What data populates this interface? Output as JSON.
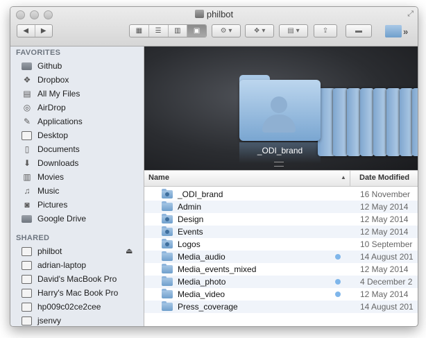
{
  "window": {
    "title": "philbot"
  },
  "toolbar": {
    "back_icon": "chevron-left-icon",
    "forward_icon": "chevron-right-icon",
    "view_modes": [
      "icon-view",
      "list-view",
      "column-view",
      "cover-flow-view"
    ],
    "active_view": "cover-flow-view",
    "more": "»"
  },
  "sidebar": {
    "favorites_header": "FAVORITES",
    "favorites": [
      {
        "label": "Github",
        "icon": "folder-icon"
      },
      {
        "label": "Dropbox",
        "icon": "dropbox-icon"
      },
      {
        "label": "All My Files",
        "icon": "all-files-icon"
      },
      {
        "label": "AirDrop",
        "icon": "airdrop-icon"
      },
      {
        "label": "Applications",
        "icon": "applications-icon"
      },
      {
        "label": "Desktop",
        "icon": "desktop-icon"
      },
      {
        "label": "Documents",
        "icon": "documents-icon"
      },
      {
        "label": "Downloads",
        "icon": "downloads-icon"
      },
      {
        "label": "Movies",
        "icon": "movies-icon"
      },
      {
        "label": "Music",
        "icon": "music-icon"
      },
      {
        "label": "Pictures",
        "icon": "pictures-icon"
      },
      {
        "label": "Google Drive",
        "icon": "folder-icon"
      }
    ],
    "shared_header": "SHARED",
    "shared": [
      {
        "label": "philbot",
        "icon": "computer-icon"
      },
      {
        "label": "adrian-laptop",
        "icon": "computer-icon"
      },
      {
        "label": "David's MacBook Pro",
        "icon": "laptop-icon"
      },
      {
        "label": "Harry's Mac Book Pro",
        "icon": "laptop-icon"
      },
      {
        "label": "hp009c02ce2cee",
        "icon": "computer-icon"
      },
      {
        "label": "jsenvy",
        "icon": "computer-icon"
      }
    ]
  },
  "coverflow": {
    "selected_label": "_ODI_brand"
  },
  "list": {
    "columns": {
      "name": "Name",
      "date": "Date Modified"
    },
    "rows": [
      {
        "name": "_ODI_brand",
        "date": "16 November",
        "shared": true,
        "tag": false
      },
      {
        "name": "Admin",
        "date": "12 May 2014",
        "shared": false,
        "tag": false
      },
      {
        "name": "Design",
        "date": "12 May 2014",
        "shared": true,
        "tag": false
      },
      {
        "name": "Events",
        "date": "12 May 2014",
        "shared": true,
        "tag": false
      },
      {
        "name": "Logos",
        "date": "10 September",
        "shared": true,
        "tag": false
      },
      {
        "name": "Media_audio",
        "date": "14 August 201",
        "shared": false,
        "tag": true
      },
      {
        "name": "Media_events_mixed",
        "date": "12 May 2014",
        "shared": false,
        "tag": false
      },
      {
        "name": "Media_photo",
        "date": "4 December 2",
        "shared": false,
        "tag": true
      },
      {
        "name": "Media_video",
        "date": "12 May 2014",
        "shared": false,
        "tag": true
      },
      {
        "name": "Press_coverage",
        "date": "14 August 201",
        "shared": false,
        "tag": false
      }
    ]
  }
}
